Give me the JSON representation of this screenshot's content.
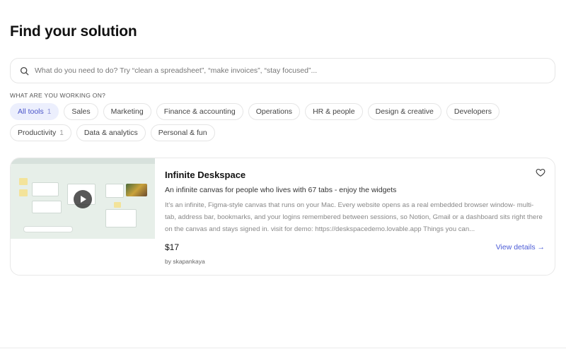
{
  "page": {
    "title": "Find your solution"
  },
  "search": {
    "icon": "search-icon",
    "placeholder": "What do you need to do? Try “clean a spreadsheet”, “make invoices”, “stay focused”..."
  },
  "filters": {
    "label": "WHAT ARE YOU WORKING ON?",
    "chips": [
      {
        "label": "All tools",
        "count": "1",
        "active": true
      },
      {
        "label": "Sales"
      },
      {
        "label": "Marketing"
      },
      {
        "label": "Finance & accounting"
      },
      {
        "label": "Operations"
      },
      {
        "label": "HR & people"
      },
      {
        "label": "Design & creative"
      },
      {
        "label": "Developers"
      },
      {
        "label": "Productivity",
        "count": "1"
      },
      {
        "label": "Data & analytics"
      },
      {
        "label": "Personal & fun"
      }
    ]
  },
  "product": {
    "name": "Infinite Deskspace",
    "tagline": "An infinite canvas for people who lives with 67 tabs - enjoy the widgets",
    "description": "It's an infinite, Figma-style canvas that runs on your Mac. Every website opens as a real embedded browser window- multi-tab, address bar, bookmarks, and your logins remembered between sessions, so Notion, Gmail or a dashboard sits right there on the canvas and stays signed in. visit for demo: https://deskspacedemo.lovable.app Things you can...",
    "price": "$17",
    "author": "by skapankaya",
    "view_label": "View details →",
    "favorite_icon": "heart-icon",
    "thumbnail_icon": "play-icon"
  },
  "colors": {
    "accent": "#4b5bd6",
    "active_chip_bg": "#eceffd"
  }
}
